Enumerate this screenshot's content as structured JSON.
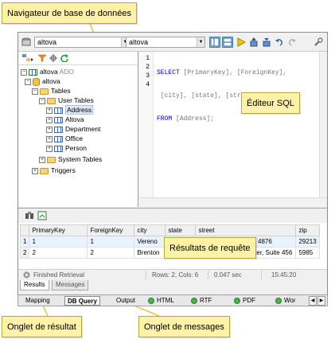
{
  "toolbar": {
    "datasource": "altova",
    "root_object": "altova"
  },
  "tree": {
    "rows": [
      {
        "name": "altova",
        "suffix": "ADO"
      },
      {
        "name": "altova",
        "suffix": ""
      },
      {
        "name": "Tables",
        "suffix": ""
      },
      {
        "name": "User Tables",
        "suffix": ""
      },
      {
        "name": "Address",
        "suffix": ""
      },
      {
        "name": "Altova",
        "suffix": ""
      },
      {
        "name": "Department",
        "suffix": ""
      },
      {
        "name": "Office",
        "suffix": ""
      },
      {
        "name": "Person",
        "suffix": ""
      },
      {
        "name": "System Tables",
        "suffix": ""
      },
      {
        "name": "Triggers",
        "suffix": ""
      }
    ]
  },
  "editor": {
    "line_numbers": [
      "1",
      "2",
      "3",
      "4"
    ],
    "lines": [
      {
        "kw": "SELECT ",
        "rest": "[PrimaryKey], [ForeignKey],"
      },
      {
        "kw": "",
        "rest": " [city], [state], [street], [zip]"
      },
      {
        "kw": "FROM ",
        "rest": "[Address];"
      },
      {
        "kw": "",
        "rest": ""
      }
    ]
  },
  "results": {
    "columns": [
      "",
      "PrimaryKey",
      "ForeignKey",
      "city",
      "state",
      "street",
      "zip"
    ],
    "rows": [
      [
        "1",
        "1",
        "1",
        "Vereno",
        "CA",
        "119 Oakstreet, Suite 4876",
        "29213"
      ],
      [
        "2",
        "2",
        "2",
        "Brenton",
        "MA",
        "9865 Millenium Center, Suite 456",
        "5985"
      ]
    ]
  },
  "status": {
    "message": "Finished Retrieval",
    "rows_cols": "Rows: 2, Cols: 6",
    "duration": "0.047 sec",
    "time": "15:45:20"
  },
  "result_tabs": [
    "Results",
    "Messages"
  ],
  "bottom_tabs": [
    "Mapping",
    "DB Query",
    "Output",
    "HTML",
    "RTF",
    "PDF",
    "Wor"
  ],
  "callouts": {
    "navigator": "Navigateur de base de données",
    "editor": "Éditeur SQL",
    "results": "Résultats de requête",
    "results_tab": "Onglet de résultat",
    "messages_tab": "Onglet de messages"
  },
  "colors": {
    "callout_bg": "#fdf2a7",
    "keyword": "#0000cc",
    "selected_row": "#e9f3ff"
  }
}
